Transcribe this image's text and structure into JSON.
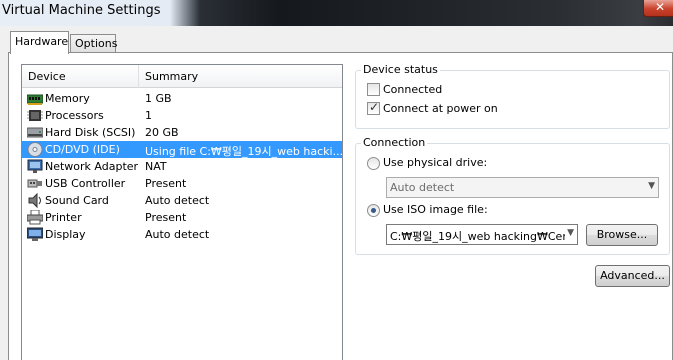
{
  "window": {
    "title": "Virtual Machine Settings",
    "close_glyph": "✕"
  },
  "tabs": [
    {
      "label": "Hardware",
      "active": true
    },
    {
      "label": "Options",
      "active": false
    }
  ],
  "device_list": {
    "columns": [
      "Device",
      "Summary"
    ],
    "rows": [
      {
        "icon": "memory-icon",
        "device": "Memory",
        "summary": "1 GB"
      },
      {
        "icon": "processor-icon",
        "device": "Processors",
        "summary": "1"
      },
      {
        "icon": "hard-disk-icon",
        "device": "Hard Disk (SCSI)",
        "summary": "20 GB"
      },
      {
        "icon": "cd-dvd-icon",
        "device": "CD/DVD (IDE)",
        "summary": "Using file C:₩평일_19시_web hacki...",
        "selected": true
      },
      {
        "icon": "network-adapter-icon",
        "device": "Network Adapter",
        "summary": "NAT"
      },
      {
        "icon": "usb-icon",
        "device": "USB Controller",
        "summary": "Present"
      },
      {
        "icon": "sound-card-icon",
        "device": "Sound Card",
        "summary": "Auto detect"
      },
      {
        "icon": "printer-icon",
        "device": "Printer",
        "summary": "Present"
      },
      {
        "icon": "display-icon",
        "device": "Display",
        "summary": "Auto detect"
      }
    ]
  },
  "device_status": {
    "label": "Device status",
    "connected": {
      "label": "Connected",
      "checked": false
    },
    "connect_at_power_on": {
      "label": "Connect at power on",
      "checked": true
    }
  },
  "connection": {
    "label": "Connection",
    "physical_drive": {
      "label": "Use physical drive:",
      "selected": false,
      "dropdown_value": "Auto detect"
    },
    "iso_image": {
      "label": "Use ISO image file:",
      "selected": true,
      "path_value": "C:₩평일_19시_web hacking₩Cer"
    },
    "browse_label": "Browse..."
  },
  "advanced_label": "Advanced...",
  "colors": {
    "selection": "#3399ff",
    "close_button": "#c9422c"
  }
}
